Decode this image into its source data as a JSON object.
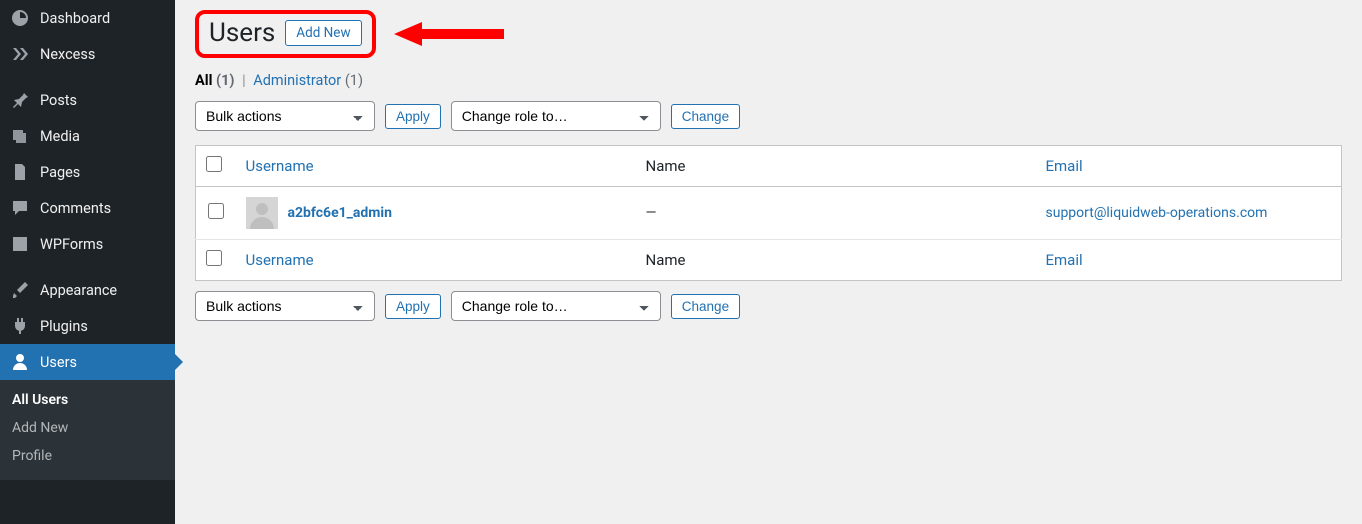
{
  "sidebar": {
    "items": [
      {
        "label": "Dashboard"
      },
      {
        "label": "Nexcess"
      },
      {
        "label": "Posts"
      },
      {
        "label": "Media"
      },
      {
        "label": "Pages"
      },
      {
        "label": "Comments"
      },
      {
        "label": "WPForms"
      },
      {
        "label": "Appearance"
      },
      {
        "label": "Plugins"
      },
      {
        "label": "Users",
        "active": true
      }
    ],
    "submenu": [
      {
        "label": "All Users",
        "current": true
      },
      {
        "label": "Add New"
      },
      {
        "label": "Profile"
      }
    ]
  },
  "header": {
    "title": "Users",
    "add_new": "Add New"
  },
  "filters": {
    "all_label": "All",
    "all_count": "(1)",
    "sep": "|",
    "admin_label": "Administrator",
    "admin_count": "(1)"
  },
  "controls": {
    "bulk_placeholder": "Bulk actions",
    "apply": "Apply",
    "role_placeholder": "Change role to…",
    "change": "Change"
  },
  "table": {
    "headers": {
      "username": "Username",
      "name": "Name",
      "email": "Email"
    },
    "rows": [
      {
        "username": "a2bfc6e1_admin",
        "name": "—",
        "email": "support@liquidweb-operations.com"
      }
    ]
  }
}
